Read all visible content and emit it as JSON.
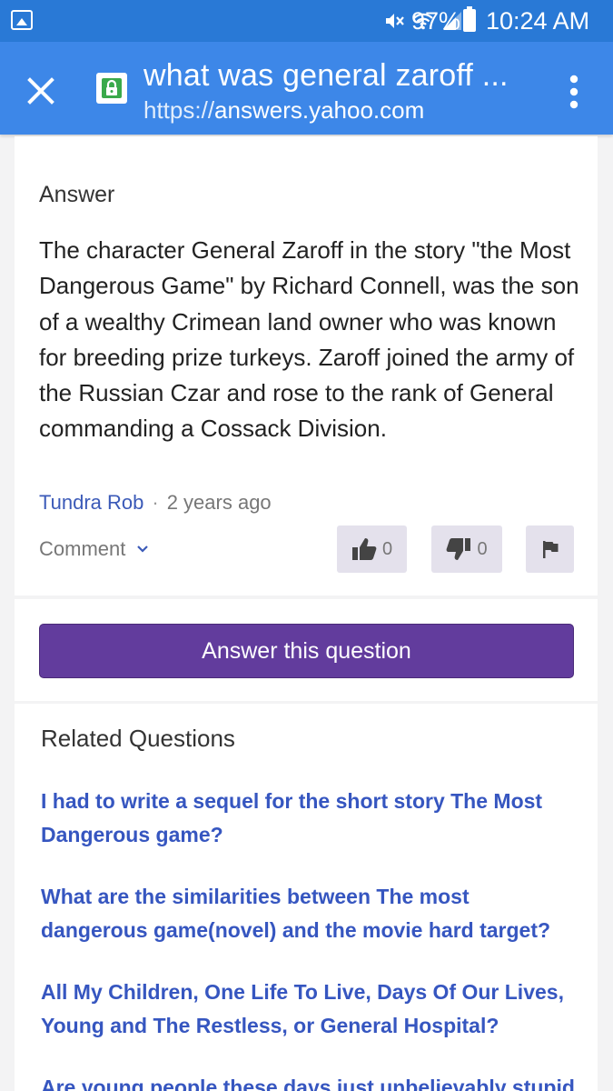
{
  "status_bar": {
    "battery": "97%",
    "time": "10:24 AM",
    "icons": [
      "gallery-icon",
      "mute-icon",
      "wifi-icon",
      "signal-icon",
      "battery-icon"
    ]
  },
  "address_bar": {
    "title": "what was general zaroff ...",
    "url_scheme": "https://",
    "url_domain": "answers.yahoo.com",
    "colors": {
      "bar": "#3d87e8",
      "status": "#2979d6",
      "lock": "#3aa94b"
    }
  },
  "answer": {
    "heading": "Answer",
    "body": "The character General Zaroff in the story \"the Most Dangerous Game\" by Richard Connell, was the son of a wealthy Crimean land owner who was known for breeding prize turkeys. Zaroff joined the army of the Russian Czar and rose to the rank of General commanding a Cossack Division.",
    "author": "Tundra Rob",
    "separator": "·",
    "time": "2 years ago",
    "comment_label": "Comment",
    "thumbs_up_count": "0",
    "thumbs_down_count": "0"
  },
  "ask": {
    "button_label": "Answer this question",
    "color": "#623c9d"
  },
  "related": {
    "heading": "Related Questions",
    "items": [
      "I had to write a sequel for the short story The Most Dangerous game?",
      "What are the similarities between The most dangerous game(novel) and the movie hard target?",
      "All My Children, One Life To Live, Days Of Our Lives, Young and The Restless, or General Hospital?",
      "Are young people these days just unbelievably stupid"
    ]
  }
}
